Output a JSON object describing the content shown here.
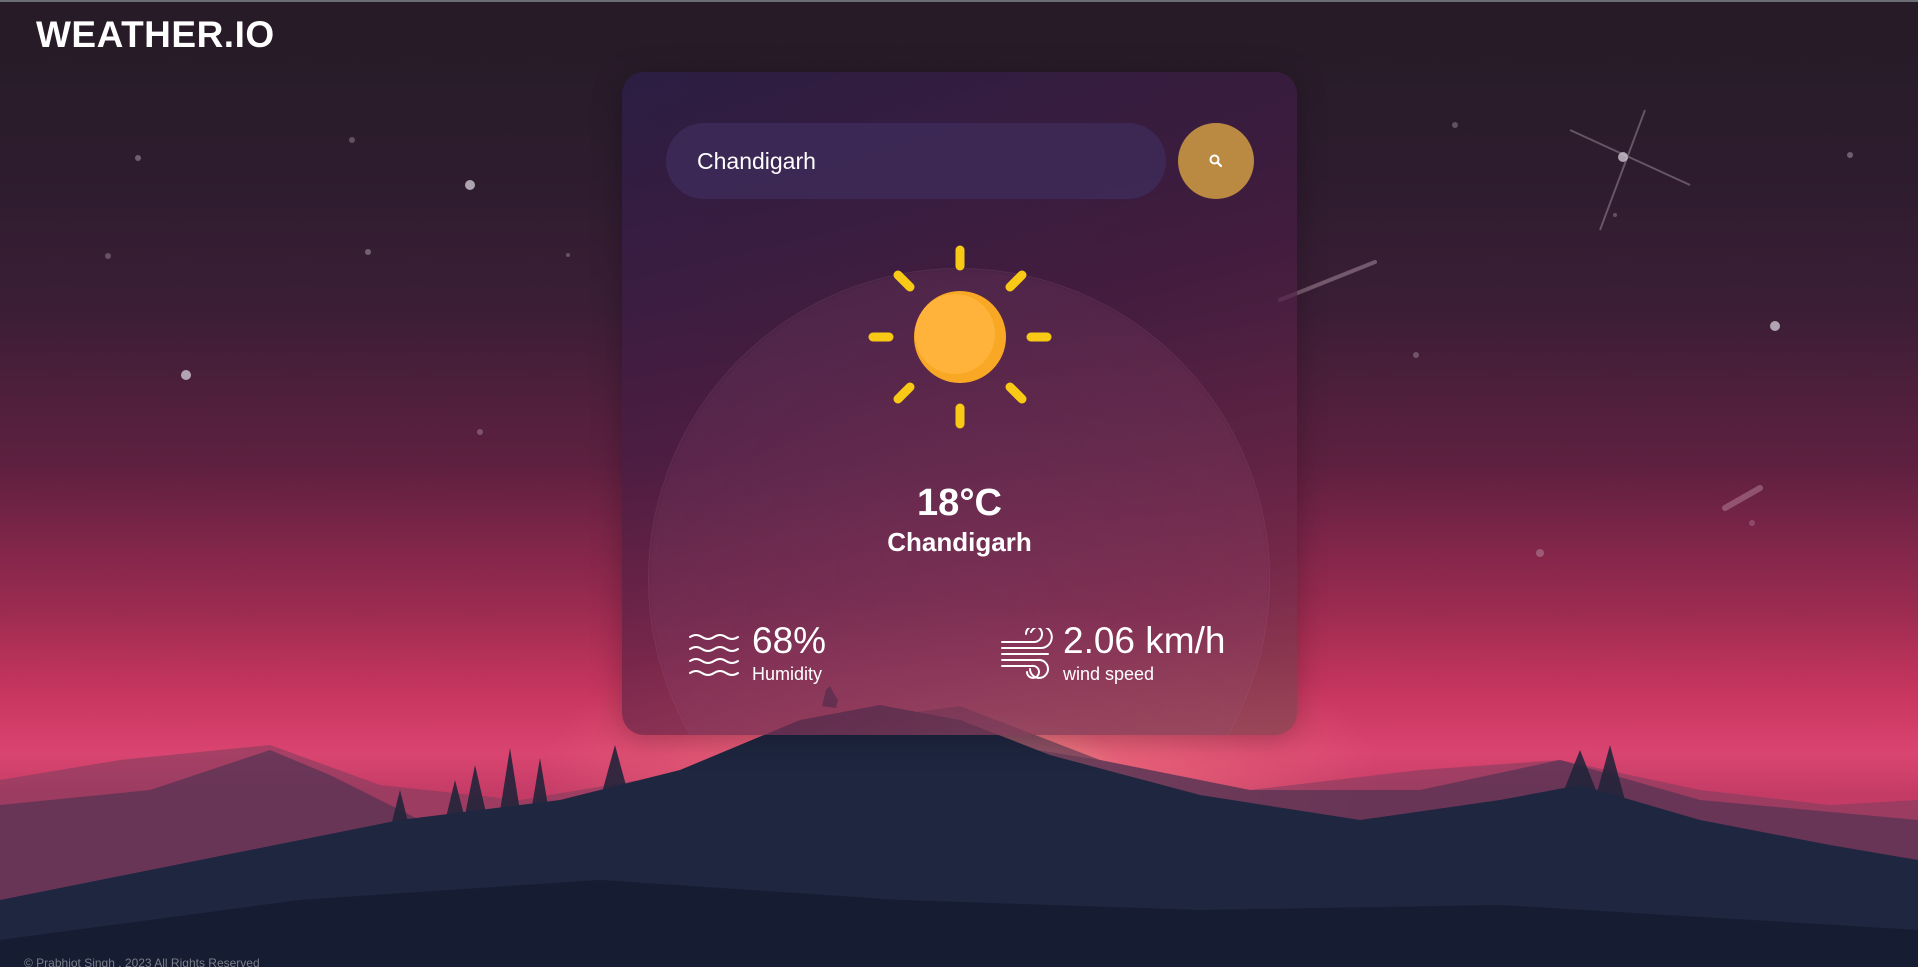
{
  "app": {
    "logo": "WEATHER.IO"
  },
  "search": {
    "value": "Chandigarh",
    "icon": "search-icon"
  },
  "weather": {
    "icon": "sun-icon",
    "temperature": "18°C",
    "city": "Chandigarh"
  },
  "details": {
    "humidity": {
      "icon": "humidity-waves-icon",
      "value": "68%",
      "label": "Humidity"
    },
    "wind": {
      "icon": "wind-icon",
      "value": "2.06 km/h",
      "label": "wind speed"
    }
  },
  "footer": {
    "text": "© Prabhjot Singh . 2023 All Rights Reserved"
  },
  "colors": {
    "search_button": "#bb8a42",
    "sun": "#fbb034",
    "sun_rays": "#f8c915",
    "text": "#ffffff"
  }
}
